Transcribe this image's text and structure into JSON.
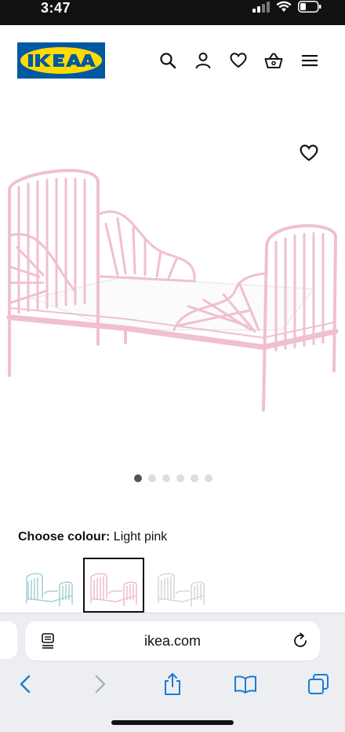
{
  "status_bar": {
    "time": "3:47"
  },
  "header": {
    "logo_text": "IKEA",
    "brand_colors": {
      "blue": "#0058a3",
      "yellow": "#ffdb00"
    },
    "icons": [
      "search-icon",
      "account-icon",
      "heart-icon",
      "basket-icon",
      "menu-icon"
    ]
  },
  "gallery": {
    "image_count": 6,
    "active_index": 0,
    "product_color": "#f2c9d9"
  },
  "colour": {
    "label": "Choose colour:",
    "value": "Light pink"
  },
  "swatches": [
    {
      "name": "Light turquoise",
      "color": "#b7dede",
      "selected": false
    },
    {
      "name": "Light pink",
      "color": "#f2c9d9",
      "selected": true
    },
    {
      "name": "White",
      "color": "#efefef",
      "selected": false
    }
  ],
  "browser": {
    "url": "ikea.com",
    "toolbar": [
      "back-icon",
      "forward-icon",
      "share-icon",
      "bookmarks-icon",
      "tabs-icon"
    ],
    "accent": "#1a7bd6"
  }
}
